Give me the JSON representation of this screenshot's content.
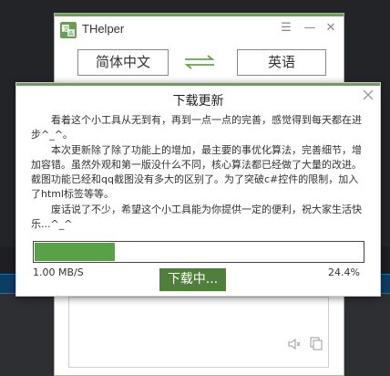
{
  "app": {
    "title": "THelper",
    "menu_glyph": "☰",
    "minimize_glyph": "—",
    "close_glyph": "✕"
  },
  "translator": {
    "source_lang": "简体中文",
    "target_lang": "英语"
  },
  "dialog": {
    "title": "下载更新",
    "paragraphs": [
      "看着这个小工具从无到有，再到一点一点的完善，感觉得到每天都在进步^_^。",
      "本次更新除了除了功能上的增加，最主要的事优化算法，完善细节，增加容错。虽然外观和第一版没什么不同，核心算法都已经做了大量的改进。截图功能已经和qq截图没有多大的区别了。为了突破c#控件的限制，加入了html标签等等。",
      "废话说了不少，希望这个小工具能为你提供一定的便利，祝大家生活快乐...^_^"
    ],
    "progress": {
      "speed": "1.00 MB/S",
      "percent_label": "24.4%",
      "fraction": 0.244
    },
    "download_button": "下载中..."
  },
  "colors": {
    "accent_green": "#6aa050",
    "button_green": "#4f7f3a",
    "progress_green": "#5aa046"
  },
  "icons": {
    "app": "app-logo-icon",
    "swap": "swap-arrows-icon",
    "close": "close-icon",
    "speaker": "speaker-icon",
    "copy": "copy-icon"
  }
}
